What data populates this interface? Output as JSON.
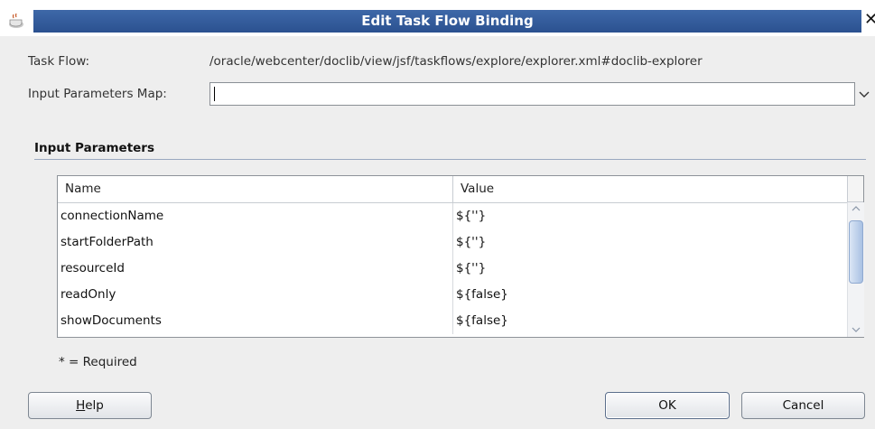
{
  "window": {
    "title": "Edit Task Flow Binding"
  },
  "icons": {
    "app": "coffee-cup-icon",
    "close": "close-icon",
    "dropdown": "chevron-down-icon"
  },
  "colors": {
    "title_bar": "#2b5190",
    "title_text": "#ffffff"
  },
  "form": {
    "task_flow_label": "Task Flow:",
    "task_flow_value": "/oracle/webcenter/doclib/view/jsf/taskflows/explore/explorer.xml#doclib-explorer",
    "input_map_label": "Input Parameters Map:",
    "input_map_value": ""
  },
  "section": {
    "title": "Input Parameters"
  },
  "table": {
    "columns": [
      "Name",
      "Value"
    ],
    "rows": [
      {
        "name": "connectionName",
        "value": "${''}"
      },
      {
        "name": "startFolderPath",
        "value": "${''}"
      },
      {
        "name": "resourceId",
        "value": "${''}"
      },
      {
        "name": "readOnly",
        "value": "${false}"
      },
      {
        "name": "showDocuments",
        "value": "${false}"
      }
    ]
  },
  "required_note": "* = Required",
  "buttons": {
    "help_first": "H",
    "help_rest": "elp",
    "ok": "OK",
    "cancel": "Cancel"
  }
}
